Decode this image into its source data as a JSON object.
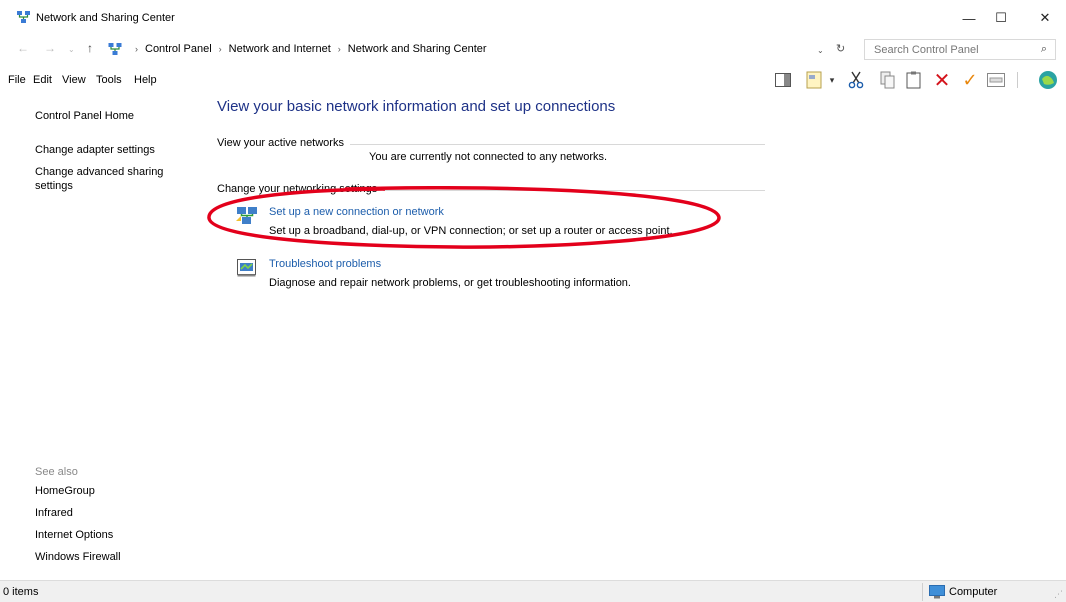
{
  "window": {
    "title": "Network and Sharing Center",
    "minimize": "—",
    "maximize": "☐",
    "close": "✕"
  },
  "address": {
    "back": "←",
    "forward": "→",
    "recent": "⌄",
    "up": "↑",
    "breadcrumbs": [
      "Control Panel",
      "Network and Internet",
      "Network and Sharing Center"
    ],
    "separator": "›",
    "dropdown": "⌄",
    "refresh": "↻",
    "search_placeholder": "Search Control Panel",
    "search_icon": "⌕"
  },
  "menu": {
    "items": [
      "File",
      "Edit",
      "View",
      "Tools",
      "Help"
    ]
  },
  "left_pane": {
    "links": [
      "Control Panel Home",
      "Change adapter settings",
      "Change advanced sharing settings"
    ],
    "see_also_label": "See also",
    "see_also": [
      "HomeGroup",
      "Infrared",
      "Internet Options",
      "Windows Firewall"
    ]
  },
  "main": {
    "title": "View your basic network information and set up connections",
    "active_networks_label": "View your active networks",
    "no_networks": "You are currently not connected to any networks.",
    "change_settings_label": "Change your networking settings",
    "tasks": [
      {
        "icon": "network-setup-icon",
        "link": "Set up a new connection or network",
        "desc": "Set up a broadband, dial-up, or VPN connection; or set up a router or access point."
      },
      {
        "icon": "troubleshoot-icon",
        "link": "Troubleshoot problems",
        "desc": "Diagnose and repair network problems, or get troubleshooting information."
      }
    ]
  },
  "status": {
    "items": "0 items",
    "location": "Computer"
  },
  "colors": {
    "title_blue": "#1e3287",
    "link_blue": "#1c5dab",
    "annotation_red": "#e3001b",
    "delete_red": "#d4141c",
    "check_orange": "#e8870e"
  }
}
